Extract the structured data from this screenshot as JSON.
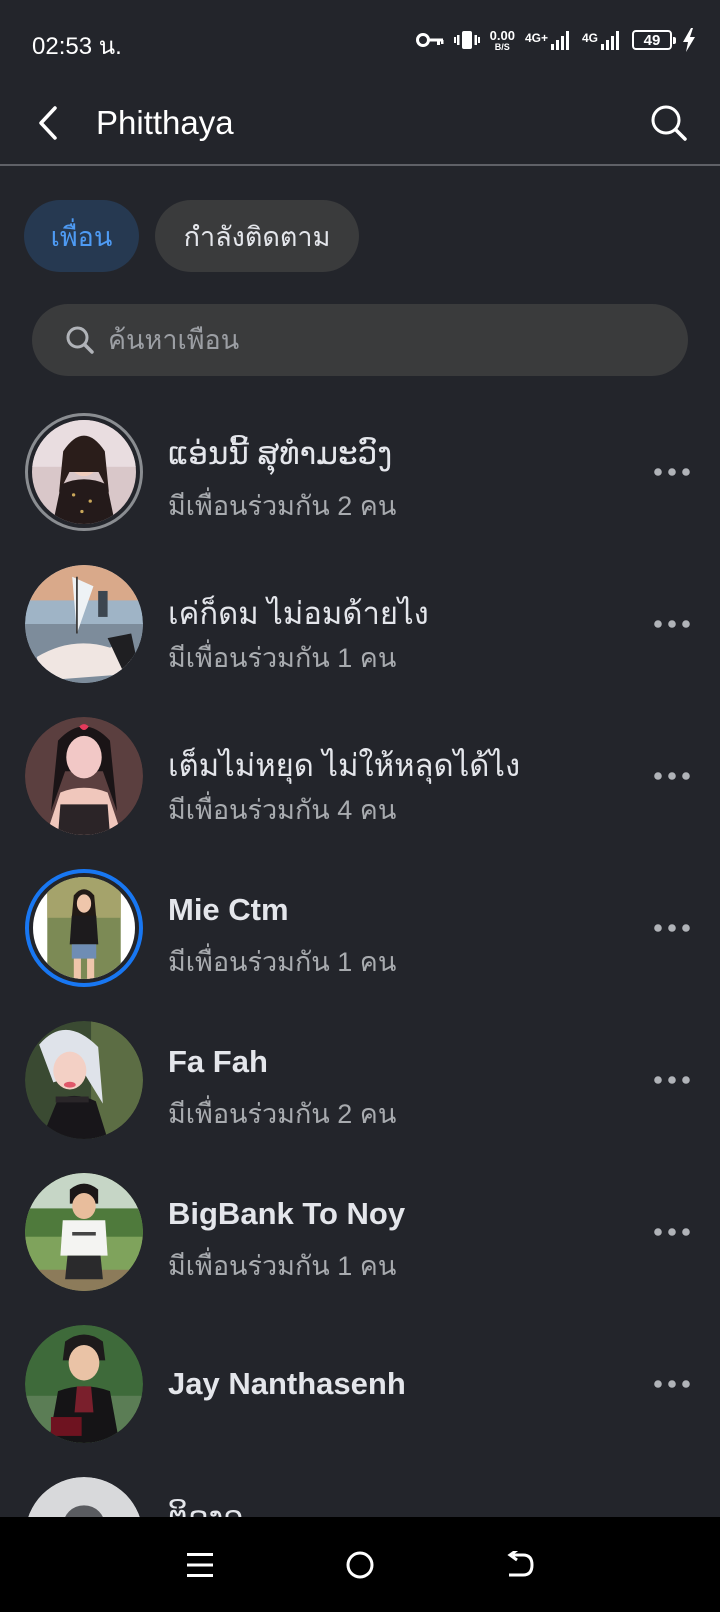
{
  "status_bar": {
    "time": "02:53 น.",
    "net_speed_value": "0.00",
    "net_speed_unit": "B/S",
    "network_1": "4G+",
    "network_2": "4G",
    "battery_level": "49",
    "icons": [
      "vpn-key-icon",
      "vibrate-icon",
      "signal-icon",
      "battery-icon",
      "charging-icon"
    ]
  },
  "header": {
    "title": "Phitthaya",
    "back_icon": "back-arrow-icon",
    "search_icon": "search-icon"
  },
  "tabs": [
    {
      "label": "เพื่อน",
      "active": true
    },
    {
      "label": "กำลังติดตาม",
      "active": false
    }
  ],
  "search": {
    "placeholder": "ค้นหาเพื่อน",
    "value": ""
  },
  "friends": [
    {
      "name": "ແອ່ນນີ້ ສຸທຳມະວົງ",
      "mutual": "มีเพื่อนร่วมกัน 2 คน",
      "story_ring": "grey"
    },
    {
      "name": "เค่ก็ดม ไม่อมด้ายไง",
      "mutual": "มีเพื่อนร่วมกัน 1 คน",
      "story_ring": "none"
    },
    {
      "name": "เต็มไม่หยุด ไม่ให้หลุดได้ไง",
      "mutual": "มีเพื่อนร่วมกัน 4 คน",
      "story_ring": "none"
    },
    {
      "name": "Mie Ctm",
      "mutual": "มีเพื่อนร่วมกัน 1 คน",
      "story_ring": "blue"
    },
    {
      "name": "Fa Fah",
      "mutual": "มีเพื่อนร่วมกัน 2 คน",
      "story_ring": "none"
    },
    {
      "name": "BigBank To Noy",
      "mutual": "มีเพื่อนร่วมกัน 1 คน",
      "story_ring": "none"
    },
    {
      "name": "Jay Nanthasenh",
      "mutual": "",
      "story_ring": "none"
    },
    {
      "name": "ຕິດຸງຈ",
      "mutual": "",
      "story_ring": "none"
    }
  ],
  "colors": {
    "background": "#23252b",
    "accent": "#4e9bf4",
    "active_tab_bg": "#263951",
    "chip_bg": "#3a3b3c",
    "story_ring_blue": "#1877f2"
  },
  "nav": {
    "icons": [
      "menu-icon",
      "home-circle-icon",
      "back-return-icon"
    ]
  }
}
